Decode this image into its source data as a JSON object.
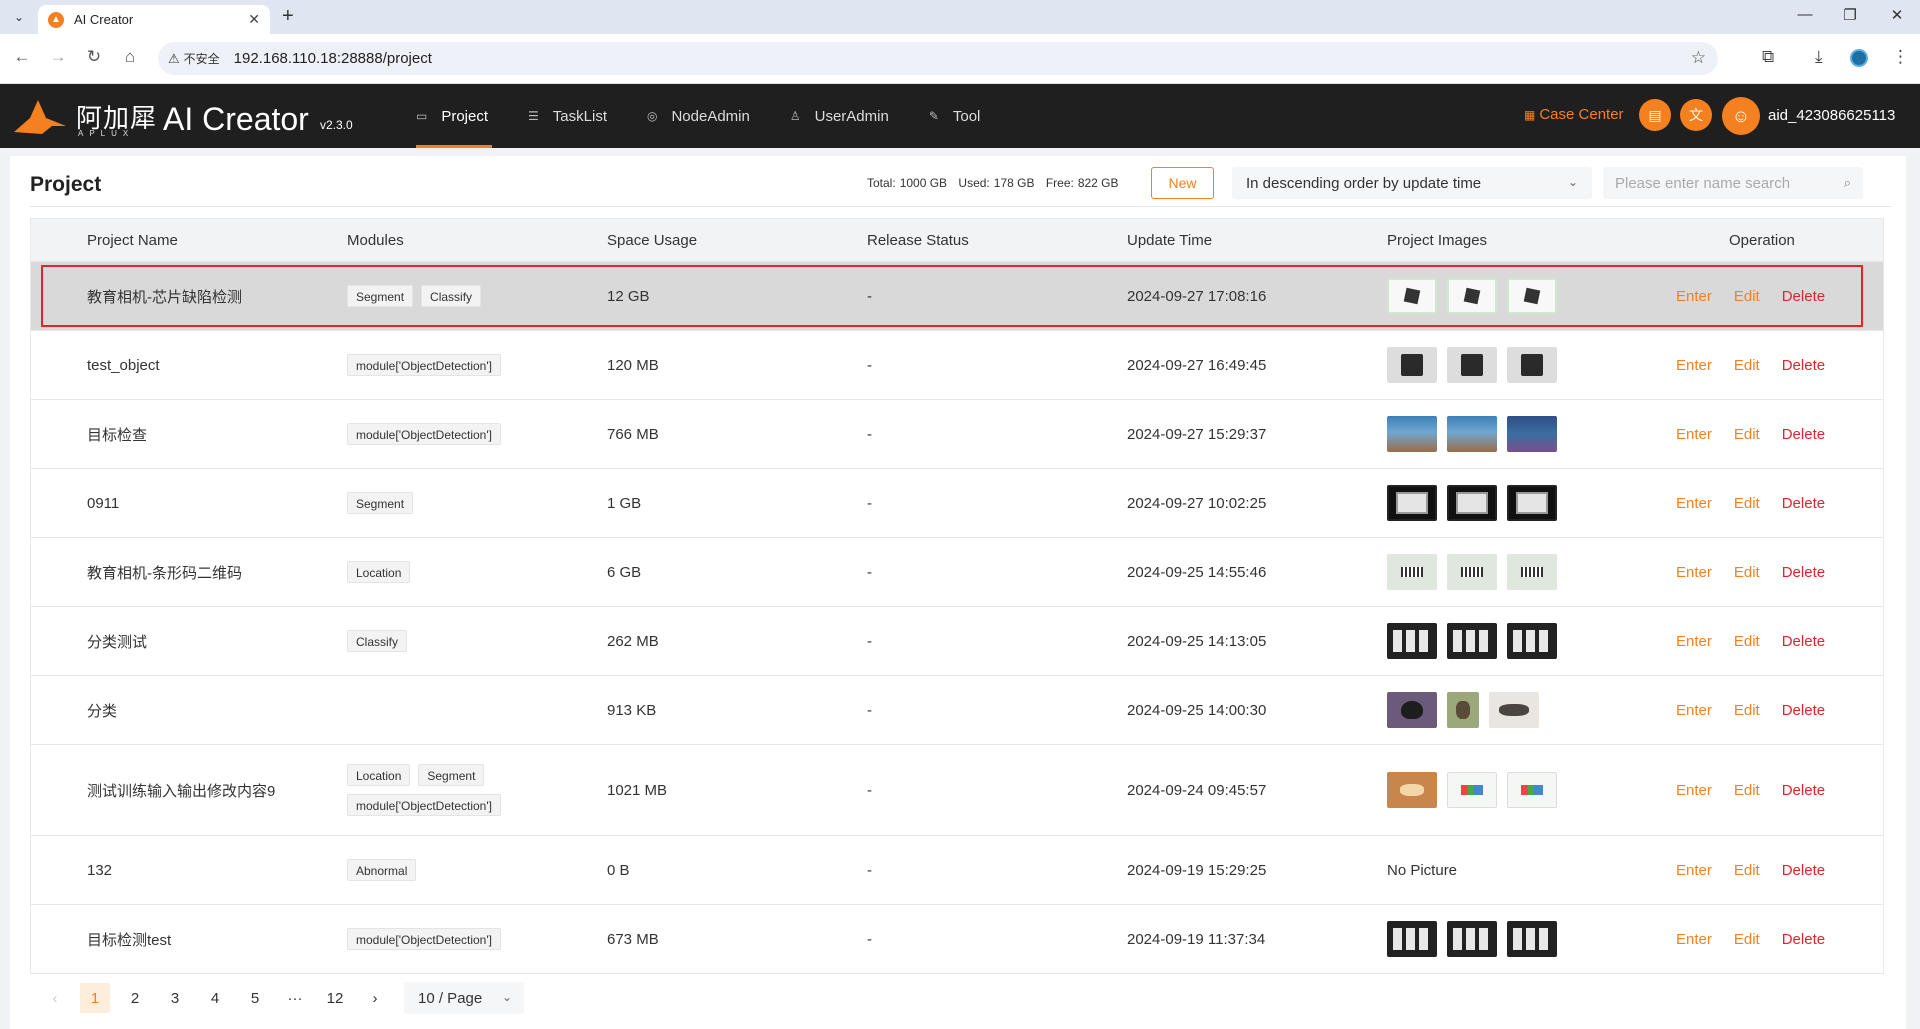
{
  "browser": {
    "tab_title": "AI Creator",
    "security_label": "不安全",
    "url": "192.168.110.18:28888/project"
  },
  "header": {
    "logo_cn": "阿加犀",
    "logo_en": "APLUX",
    "app_name": "AI Creator",
    "version": "v2.3.0",
    "nav": [
      {
        "label": "Project",
        "icon": "folder-icon",
        "active": true
      },
      {
        "label": "TaskList",
        "icon": "list-icon",
        "active": false
      },
      {
        "label": "NodeAdmin",
        "icon": "node-icon",
        "active": false
      },
      {
        "label": "UserAdmin",
        "icon": "users-icon",
        "active": false
      },
      {
        "label": "Tool",
        "icon": "wrench-icon",
        "active": false
      }
    ],
    "case_center": "Case Center",
    "user": "aid_423086625113",
    "accent": "#f5801f"
  },
  "main": {
    "title": "Project",
    "storage": {
      "total_label": "Total:",
      "total": "1000 GB",
      "used_label": "Used:",
      "used": "178 GB",
      "free_label": "Free:",
      "free": "822 GB"
    },
    "new_label": "New",
    "sort_value": "In descending order by update time",
    "search_placeholder": "Please enter name search",
    "columns": [
      "Project Name",
      "Modules",
      "Space Usage",
      "Release Status",
      "Update Time",
      "Project Images",
      "Operation"
    ],
    "rows": [
      {
        "name": "教育相机-芯片缺陷检测",
        "modules": [
          "Segment",
          "Classify"
        ],
        "space": "12 GB",
        "release": "-",
        "time": "2024-09-27 17:08:16",
        "thumbs": [
          "t-chip",
          "t-chip",
          "t-chip"
        ]
      },
      {
        "name": "test_object",
        "modules": [
          "module['ObjectDetection']"
        ],
        "space": "120 MB",
        "release": "-",
        "time": "2024-09-27 16:49:45",
        "thumbs": [
          "t-dark",
          "t-dark",
          "t-dark"
        ]
      },
      {
        "name": "目标检查",
        "modules": [
          "module['ObjectDetection']"
        ],
        "space": "766 MB",
        "release": "-",
        "time": "2024-09-27 15:29:37",
        "thumbs": [
          "t-game",
          "t-game",
          "t-game2"
        ]
      },
      {
        "name": "0911",
        "modules": [
          "Segment"
        ],
        "space": "1 GB",
        "release": "-",
        "time": "2024-09-27 10:02:25",
        "thumbs": [
          "t-dev",
          "t-dev",
          "t-dev"
        ]
      },
      {
        "name": "教育相机-条形码二维码",
        "modules": [
          "Location"
        ],
        "space": "6 GB",
        "release": "-",
        "time": "2024-09-25 14:55:46",
        "thumbs": [
          "t-barcode",
          "t-barcode",
          "t-barcode"
        ]
      },
      {
        "name": "分类测试",
        "modules": [
          "Classify"
        ],
        "space": "262 MB",
        "release": "-",
        "time": "2024-09-25 14:13:05",
        "thumbs": [
          "t-remote",
          "t-remote",
          "t-remote"
        ]
      },
      {
        "name": "分类",
        "modules": [],
        "space": "913 KB",
        "release": "-",
        "time": "2024-09-25 14:00:30",
        "thumbs": [
          "t-cat",
          "t-cat2",
          "t-cat3"
        ]
      },
      {
        "name": "测试训练输入输出修改内容9",
        "modules": [
          "Location",
          "Segment",
          "module['ObjectDetection']"
        ],
        "space": "1021 MB",
        "release": "-",
        "time": "2024-09-24 09:45:57",
        "thumbs": [
          "t-cat4",
          "t-chart",
          "t-chart"
        ]
      },
      {
        "name": "132",
        "modules": [
          "Abnormal"
        ],
        "space": "0 B",
        "release": "-",
        "time": "2024-09-19 15:29:25",
        "thumbs": [],
        "no_picture": "No Picture"
      },
      {
        "name": "目标检测test",
        "modules": [
          "module['ObjectDetection']"
        ],
        "space": "673 MB",
        "release": "-",
        "time": "2024-09-19 11:37:34",
        "thumbs": [
          "t-remote",
          "t-remote",
          "t-remote"
        ]
      }
    ],
    "ops": {
      "enter": "Enter",
      "edit": "Edit",
      "delete": "Delete"
    }
  },
  "pagination": {
    "pages": [
      "1",
      "2",
      "3",
      "4",
      "5",
      "···",
      "12"
    ],
    "current": "1",
    "page_size": "10 / Page"
  }
}
